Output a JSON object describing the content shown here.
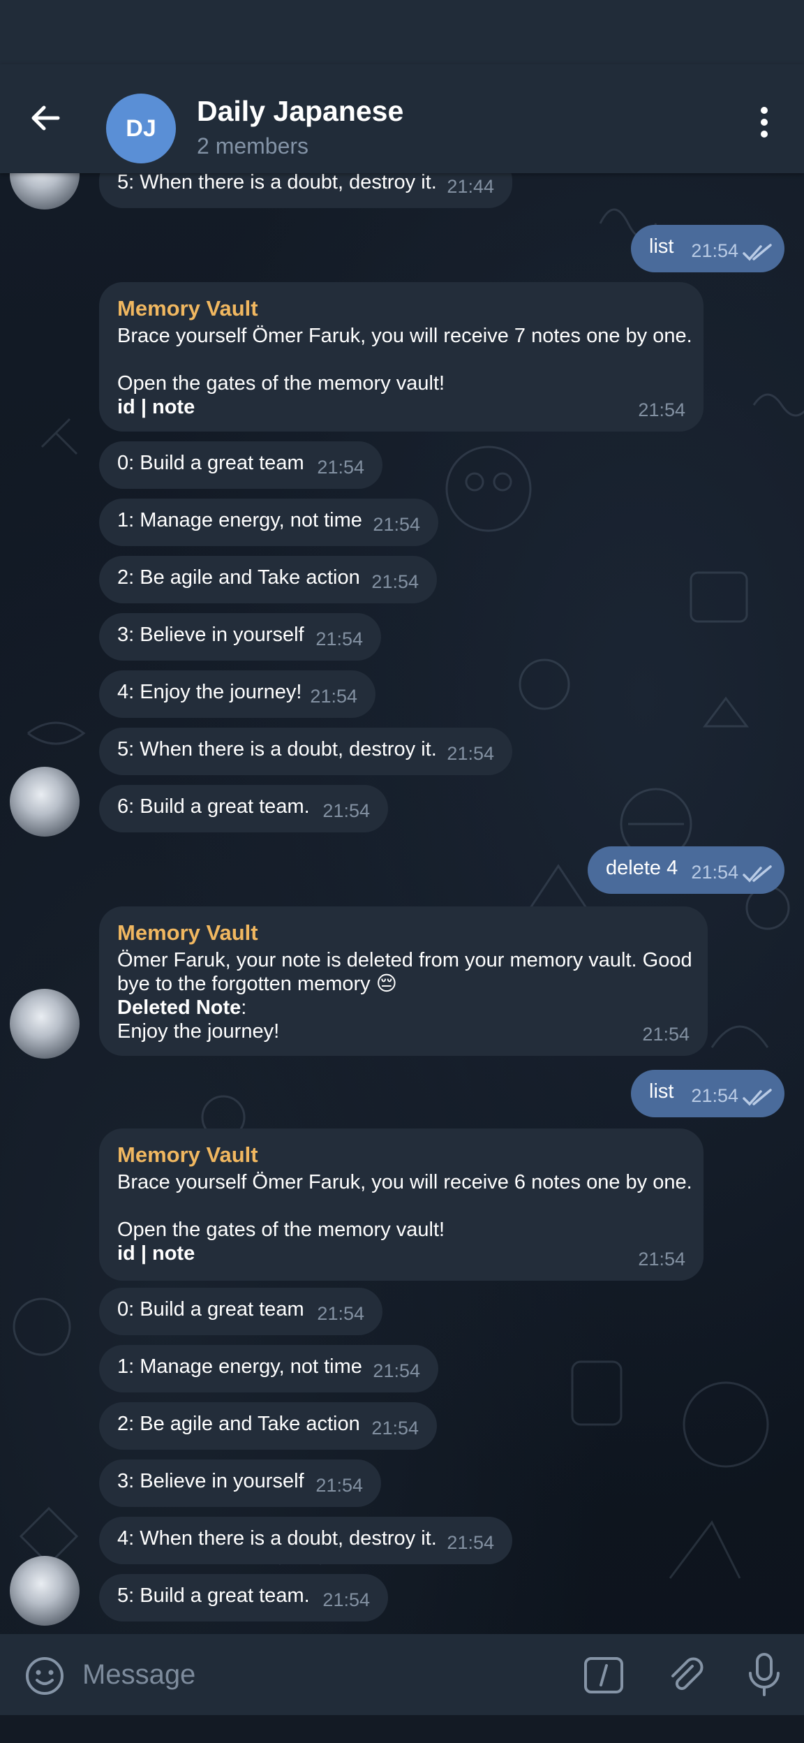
{
  "header": {
    "avatar_initials": "DJ",
    "title": "Daily Japanese",
    "subtitle": "2 members"
  },
  "messages": [
    {
      "text": "5: When there is a doubt, destroy it.",
      "time": "21:44"
    },
    {
      "text": "list",
      "time": "21:54"
    },
    {
      "sender": "Memory Vault",
      "lines": [
        "Brace yourself Ömer Faruk, you will receive 7 notes one by one.",
        "Open the gates of the memory vault!",
        "id | note"
      ],
      "time": "21:54"
    },
    {
      "text": "0: Build a great team",
      "time": "21:54"
    },
    {
      "text": "1: Manage energy, not time",
      "time": "21:54"
    },
    {
      "text": "2: Be agile and Take action",
      "time": "21:54"
    },
    {
      "text": "3: Believe in yourself",
      "time": "21:54"
    },
    {
      "text": "4: Enjoy the journey!",
      "time": "21:54"
    },
    {
      "text": "5: When there is a doubt, destroy it.",
      "time": "21:54"
    },
    {
      "text": "6: Build a great team.",
      "time": "21:54"
    },
    {
      "text": "delete 4",
      "time": "21:54"
    },
    {
      "sender": "Memory Vault",
      "lines": [
        "Ömer Faruk, your note is deleted from your memory vault. Good",
        "bye to the forgotten memory 😔",
        "Deleted Note",
        ":",
        "Enjoy the journey!"
      ],
      "time": "21:54"
    },
    {
      "text": "list",
      "time": "21:54"
    },
    {
      "sender": "Memory Vault",
      "lines": [
        "Brace yourself Ömer Faruk, you will receive 6 notes one by one.",
        "Open the gates of the memory vault!",
        "id | note"
      ],
      "time": "21:54"
    },
    {
      "text": "0: Build a great team",
      "time": "21:54"
    },
    {
      "text": "1: Manage energy, not time",
      "time": "21:54"
    },
    {
      "text": "2: Be agile and Take action",
      "time": "21:54"
    },
    {
      "text": "3: Believe in yourself",
      "time": "21:54"
    },
    {
      "text": "4: When there is a doubt, destroy it.",
      "time": "21:54"
    },
    {
      "text": "5: Build a great team.",
      "time": "21:54"
    }
  ],
  "composer": {
    "placeholder": "Message"
  },
  "colors": {
    "header_bg": "#212c39",
    "incoming_bubble": "#232d3a",
    "outgoing_bubble": "#4a6b9b",
    "sender_name": "#f0b760",
    "avatar_blue": "#5a8fd6"
  },
  "icons": [
    "back-arrow-icon",
    "more-vertical-icon",
    "double-check-icon",
    "emoji-icon",
    "bot-command-icon",
    "attach-icon",
    "mic-icon"
  ]
}
